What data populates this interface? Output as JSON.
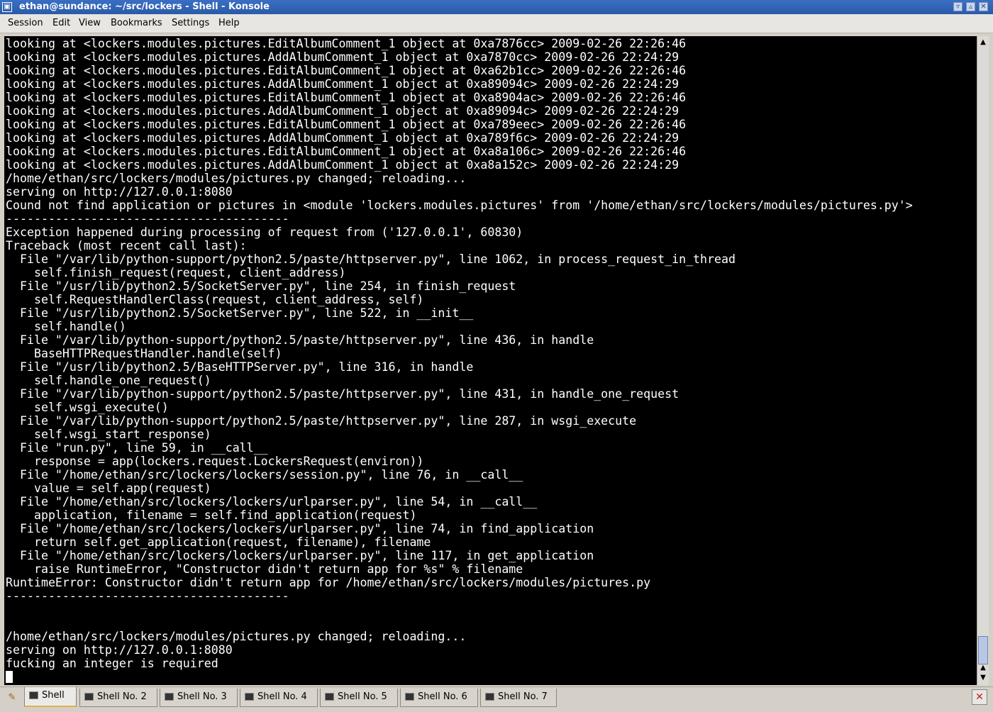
{
  "window": {
    "title": "ethan@sundance: ~/src/lockers - Shell - Konsole",
    "buttons": [
      "▿",
      "▵",
      "✕"
    ]
  },
  "menu": [
    "Session",
    "Edit",
    "View",
    "Bookmarks",
    "Settings",
    "Help"
  ],
  "terminal": {
    "lines": [
      "looking at <lockers.modules.pictures.EditAlbumComment_1 object at 0xa7876cc> 2009-02-26 22:26:46",
      "looking at <lockers.modules.pictures.AddAlbumComment_1 object at 0xa7870cc> 2009-02-26 22:24:29",
      "looking at <lockers.modules.pictures.EditAlbumComment_1 object at 0xa62b1cc> 2009-02-26 22:26:46",
      "looking at <lockers.modules.pictures.AddAlbumComment_1 object at 0xa89094c> 2009-02-26 22:24:29",
      "looking at <lockers.modules.pictures.EditAlbumComment_1 object at 0xa8904ac> 2009-02-26 22:26:46",
      "looking at <lockers.modules.pictures.AddAlbumComment_1 object at 0xa89094c> 2009-02-26 22:24:29",
      "looking at <lockers.modules.pictures.EditAlbumComment_1 object at 0xa789eec> 2009-02-26 22:26:46",
      "looking at <lockers.modules.pictures.AddAlbumComment_1 object at 0xa789f6c> 2009-02-26 22:24:29",
      "looking at <lockers.modules.pictures.EditAlbumComment_1 object at 0xa8a106c> 2009-02-26 22:26:46",
      "looking at <lockers.modules.pictures.AddAlbumComment_1 object at 0xa8a152c> 2009-02-26 22:24:29",
      "/home/ethan/src/lockers/modules/pictures.py changed; reloading...",
      "serving on http://127.0.0.1:8080",
      "Cound not find application or pictures in <module 'lockers.modules.pictures' from '/home/ethan/src/lockers/modules/pictures.py'>",
      "----------------------------------------",
      "Exception happened during processing of request from ('127.0.0.1', 60830)",
      "Traceback (most recent call last):",
      "  File \"/var/lib/python-support/python2.5/paste/httpserver.py\", line 1062, in process_request_in_thread",
      "    self.finish_request(request, client_address)",
      "  File \"/usr/lib/python2.5/SocketServer.py\", line 254, in finish_request",
      "    self.RequestHandlerClass(request, client_address, self)",
      "  File \"/usr/lib/python2.5/SocketServer.py\", line 522, in __init__",
      "    self.handle()",
      "  File \"/var/lib/python-support/python2.5/paste/httpserver.py\", line 436, in handle",
      "    BaseHTTPRequestHandler.handle(self)",
      "  File \"/usr/lib/python2.5/BaseHTTPServer.py\", line 316, in handle",
      "    self.handle_one_request()",
      "  File \"/var/lib/python-support/python2.5/paste/httpserver.py\", line 431, in handle_one_request",
      "    self.wsgi_execute()",
      "  File \"/var/lib/python-support/python2.5/paste/httpserver.py\", line 287, in wsgi_execute",
      "    self.wsgi_start_response)",
      "  File \"run.py\", line 59, in __call__",
      "    response = app(lockers.request.LockersRequest(environ))",
      "  File \"/home/ethan/src/lockers/lockers/session.py\", line 76, in __call__",
      "    value = self.app(request)",
      "  File \"/home/ethan/src/lockers/lockers/urlparser.py\", line 54, in __call__",
      "    application, filename = self.find_application(request)",
      "  File \"/home/ethan/src/lockers/lockers/urlparser.py\", line 74, in find_application",
      "    return self.get_application(request, filename), filename",
      "  File \"/home/ethan/src/lockers/lockers/urlparser.py\", line 117, in get_application",
      "    raise RuntimeError, \"Constructor didn't return app for %s\" % filename",
      "RuntimeError: Constructor didn't return app for /home/ethan/src/lockers/modules/pictures.py",
      "----------------------------------------",
      "",
      "",
      "/home/ethan/src/lockers/modules/pictures.py changed; reloading...",
      "serving on http://127.0.0.1:8080",
      "fucking an integer is required"
    ]
  },
  "scrollbar": {
    "up": "▲",
    "down": "▼",
    "position": 0.95
  },
  "tabs": [
    "Shell",
    "Shell No. 2",
    "Shell No. 3",
    "Shell No. 4",
    "Shell No. 5",
    "Shell No. 6",
    "Shell No. 7"
  ],
  "active_tab": 0
}
